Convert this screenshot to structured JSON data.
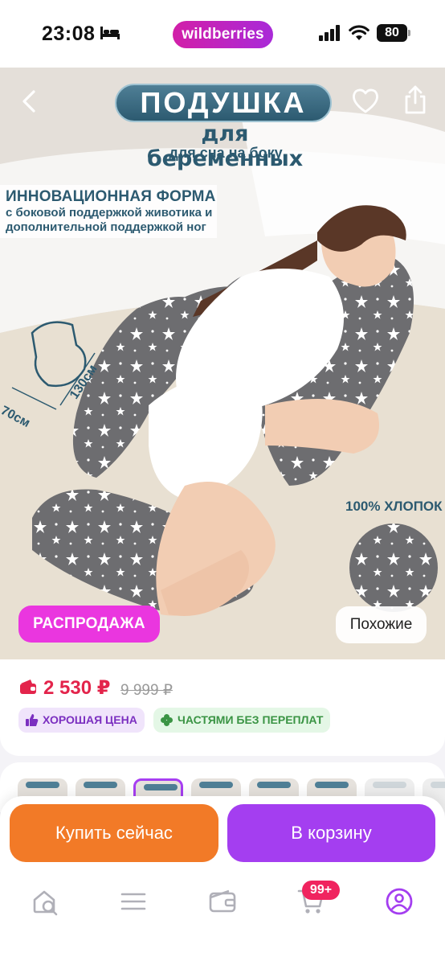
{
  "status_bar": {
    "time": "23:08",
    "brand": "wildberries",
    "battery": "80"
  },
  "hero": {
    "title": "ПОДУШКА",
    "subtitle": "для беременных",
    "subtitle_small": "для сна на боку",
    "promo_heading": "ИННОВАЦИОННАЯ ФОРМА",
    "promo_line1": "с боковой поддержкой животика и",
    "promo_line2": "дополнительной поддержкой ног",
    "dimension_width": "70см",
    "dimension_length": "130см",
    "material": "100% ХЛОПОК",
    "sale_badge": "РАСПРОДАЖА",
    "similar_button": "Похожие"
  },
  "price_card": {
    "price": "2 530 ₽",
    "old_price": "9 999 ₽",
    "badges": [
      {
        "label": "ХОРОШАЯ ЦЕНА",
        "icon": "thumbs-up-icon"
      },
      {
        "label": "ЧАСТЯМИ БЕЗ ПЕРЕПЛАТ",
        "icon": "clover-icon"
      }
    ]
  },
  "gallery": {
    "thumbnail_count": 8,
    "active_index": 2
  },
  "actions": {
    "buy_now": "Купить сейчас",
    "add_to_cart": "В корзину"
  },
  "nav": {
    "items": [
      {
        "icon": "home-search-icon"
      },
      {
        "icon": "catalog-menu-icon"
      },
      {
        "icon": "wallet-icon"
      },
      {
        "icon": "cart-icon"
      },
      {
        "icon": "profile-icon"
      }
    ],
    "cart_count": "99+"
  },
  "colors": {
    "brand": "#cb11ab",
    "buy_now": "#f27a27",
    "add_to_cart": "#a43ef0",
    "price": "#e3244b",
    "sale": "#ea36df"
  }
}
